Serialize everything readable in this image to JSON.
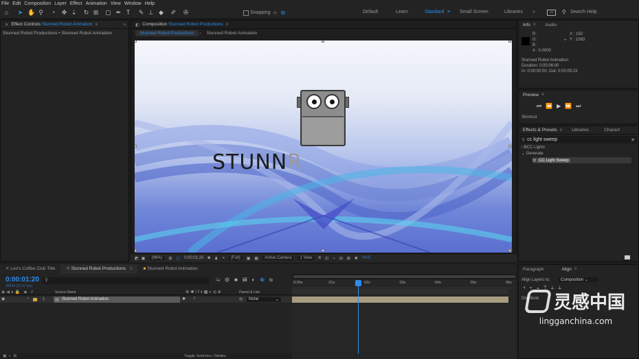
{
  "menu": [
    "File",
    "Edit",
    "Composition",
    "Layer",
    "Effect",
    "Animation",
    "View",
    "Window",
    "Help"
  ],
  "toolbar": {
    "snapping_label": "Snapping",
    "workspaces": [
      "Default",
      "Learn",
      "Standard",
      "Small Screen",
      "Libraries"
    ],
    "active_workspace": "Standard",
    "search_placeholder": "Search Help"
  },
  "effect_controls": {
    "tab_label": "Effect Controls",
    "tab_comp": "Stunned Robot Animation",
    "breadcrumb": "Stunned Robot Productions • Stunned Robot Animation"
  },
  "composition": {
    "tab_label": "Composition",
    "tab_comp": "Stunned Robot Productions",
    "crumbs": [
      "Stunned Robot Productions",
      "Stunned Robot Animation"
    ],
    "logo_text_dark": "STUNN",
    "logo_text_light": "R"
  },
  "viewer_controls": {
    "zoom": "(96%)",
    "timecode": "0;00;01;20",
    "resolution": "(Full)",
    "camera": "Active Camera",
    "views": "1 View",
    "exposure": "+0.0"
  },
  "info_panel": {
    "tabs": [
      "Info",
      "Audio"
    ],
    "r_label": "R :",
    "g_label": "G :",
    "b_label": "B :",
    "a_label": "A :  0.0000",
    "x_label": "X : 150",
    "y_label": "Y : 1083",
    "comp_name": "Stunned Robot Animation",
    "duration": "Duration: 0;00;06;00",
    "in_out": "In: 0;00;00;00, Out: 0;00;05;23"
  },
  "preview_panel": {
    "title": "Preview",
    "shortcut_label": "Shortcut"
  },
  "effects_panel": {
    "tabs": [
      "Effects & Presets",
      "Libraries",
      "Charact"
    ],
    "search_value": "cc light sweep",
    "tree": [
      "BCC Lights",
      "Generate",
      "CC Light Sweep"
    ]
  },
  "align_panel": {
    "tabs": [
      "Paragraph",
      "Align"
    ],
    "align_to_label": "Align Layers to:",
    "align_to_value": "Composition",
    "distribute_label": "Distribute"
  },
  "timeline": {
    "tabs": [
      "Leo's Coffee Club Title",
      "Stunned Robot Productions",
      "Stunned Robot Animation"
    ],
    "active_tab": "Stunned Robot Productions",
    "current_time": "0:00:01:20",
    "fps_info": "00044 (29.97 fps)",
    "columns": [
      "Source Name",
      "Parent & Link"
    ],
    "ruler": [
      "0:00s",
      "01s",
      "02s",
      "03s",
      "04s",
      "05s",
      "06s"
    ],
    "layer_index": "1",
    "layer_name": "Stunned Robot Animation",
    "parent_value": "None",
    "toggle_label": "Toggle Switches / Modes"
  },
  "watermark": {
    "chinese": "灵感中国",
    "url": "lingganchina.com"
  },
  "colors": {
    "accent": "#2d8ceb",
    "panel_bg": "#232323",
    "layer_bar": "#a89c80"
  }
}
